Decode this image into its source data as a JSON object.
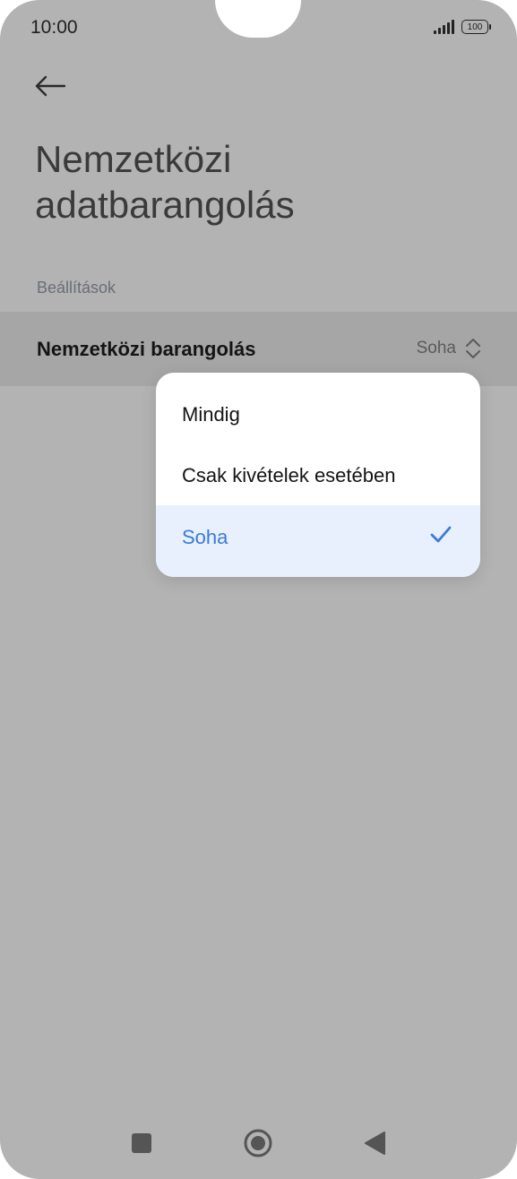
{
  "status_bar": {
    "time": "10:00",
    "battery": "100",
    "icons": [
      "signal-icon",
      "battery-icon"
    ]
  },
  "header": {
    "back_icon": "arrow-left-icon",
    "title": "Nemzetközi\nadatbarangolás"
  },
  "section": {
    "header": "Beállítások"
  },
  "setting": {
    "label": "Nemzetközi barangolás",
    "value": "Soha",
    "icon": "chevron-up-down-icon"
  },
  "dropdown": {
    "options": [
      {
        "label": "Mindig",
        "selected": false
      },
      {
        "label": "Csak kivételek esetében",
        "selected": false
      },
      {
        "label": "Soha",
        "selected": true
      }
    ],
    "selected_icon": "check-icon",
    "accent_color": "#3a7ad9"
  },
  "nav_bar": {
    "icons": [
      "recent-apps-icon",
      "home-icon",
      "back-icon"
    ]
  }
}
